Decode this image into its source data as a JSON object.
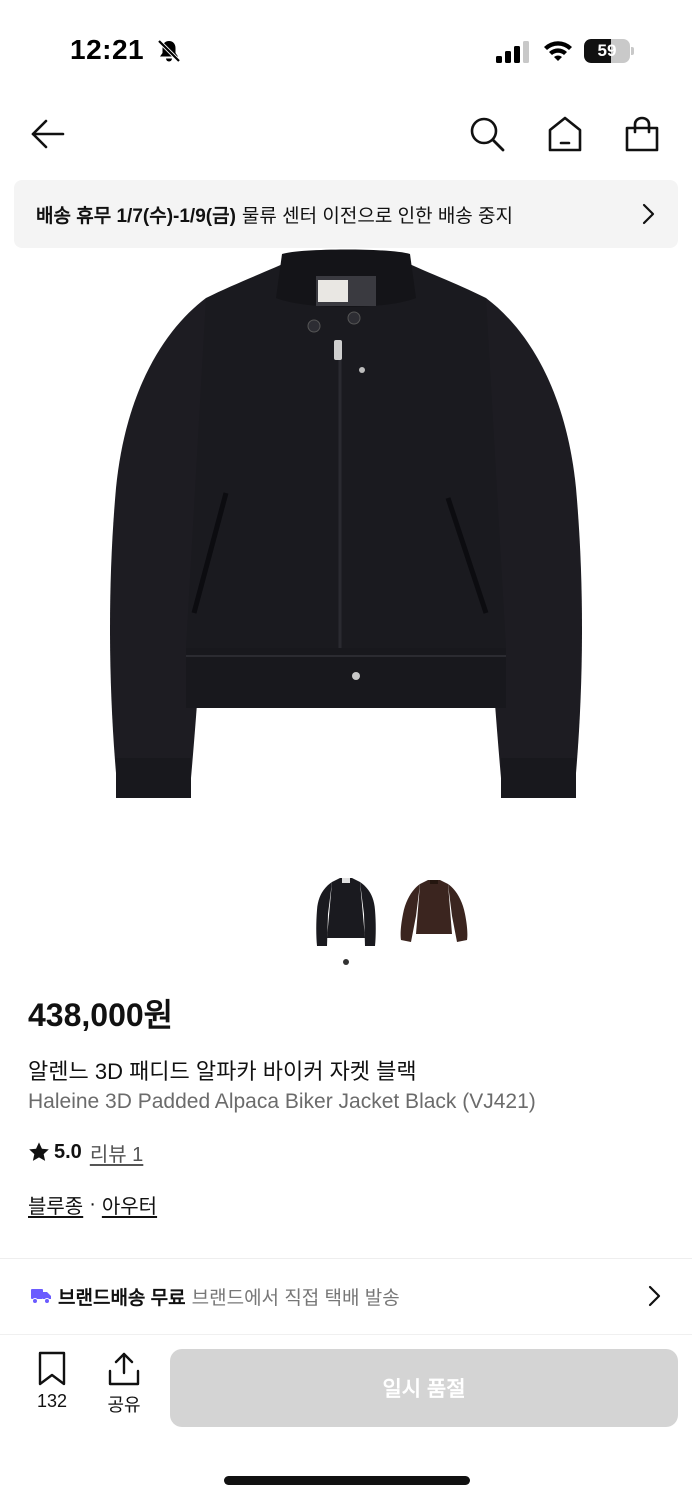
{
  "status_bar": {
    "time": "12:21",
    "battery_level": "59",
    "battery_fraction": 0.59,
    "icons": [
      "bell-slash-icon",
      "signal-icon",
      "wifi-icon",
      "battery-icon"
    ]
  },
  "nav": {
    "icons": [
      "back-arrow-icon",
      "search-icon",
      "home-icon",
      "shopping-bag-icon"
    ]
  },
  "notice": {
    "bold": "배송 휴무 1/7(수)-1/9(금)",
    "text": "물류 센터 이전으로 인한 배송 중지"
  },
  "product": {
    "price": "438,000원",
    "name_ko": "알렌느 3D 패디드 알파카 바이커 자켓 블랙",
    "name_en": "Haleine 3D Padded Alpaca Biker Jacket Black (VJ421)",
    "rating": "5.0",
    "review_label": "리뷰 1",
    "category": [
      "블루종",
      "아우터"
    ],
    "category_sep": "·",
    "thumbnails": [
      "black-jacket",
      "brown-jacket"
    ],
    "selected_thumbnail": 1
  },
  "shipping": {
    "bold": "브랜드배송 무료",
    "text": "브랜드에서 직접 택배 발송"
  },
  "bottom_bar": {
    "like_count": "132",
    "share_label": "공유",
    "soldout_label": "일시 품절"
  },
  "colors": {
    "accent_truck": "#6b5bff",
    "soldout_bg": "#d4d4d4",
    "jacket_black": "#1a1a1f",
    "jacket_brown": "#3b251f"
  }
}
